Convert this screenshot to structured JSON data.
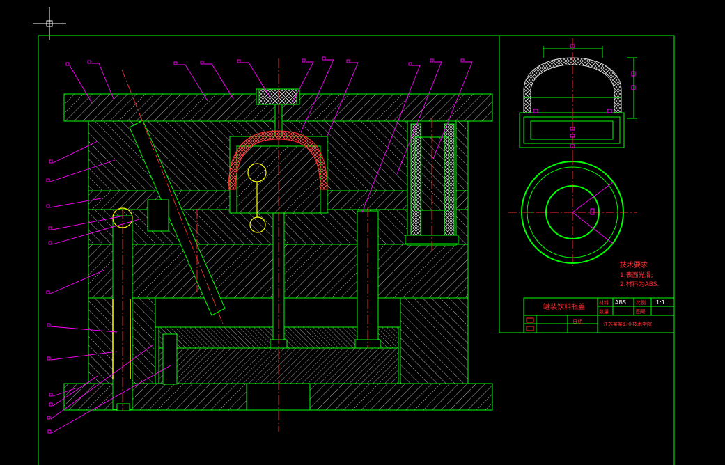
{
  "colors": {
    "background": "#000000",
    "outline": "#00ff00",
    "hatch": "#dddddd",
    "leader": "#ff00ff",
    "centerline": "#ff3030",
    "annotation_red": "#ff3030",
    "highlight": "#ffff00",
    "part": "#cc2020"
  },
  "icons": [
    "crosshair-cursor-icon"
  ],
  "technical_requirements": {
    "heading": "技术要求",
    "item1": "1.表面光滑;",
    "item2": "2.材料为ABS."
  },
  "title_block": {
    "drawing_name": "罐装饮料瓶盖",
    "material_label": "材料",
    "material": "ABS",
    "scale_label": "比例",
    "scale": "1:1",
    "quantity_label": "数量",
    "drawing_no_label": "图号",
    "date_label": "日期",
    "school": "江苏某某职业技术学院"
  }
}
